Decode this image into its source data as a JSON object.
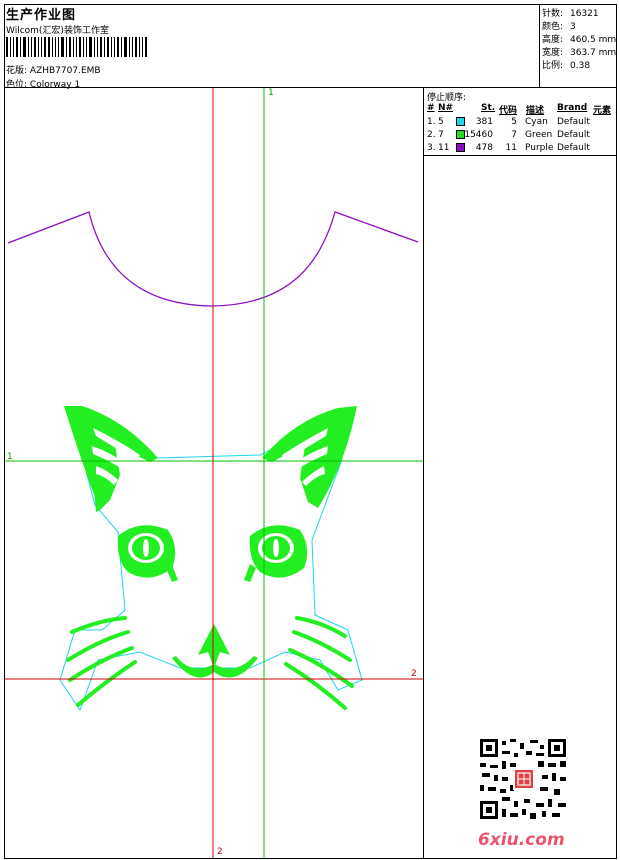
{
  "header": {
    "title": "生产作业图",
    "company": "Wilcom(汇宏)装饰工作室",
    "design_label": "花版:",
    "design_file": "AZHB7707.EMB",
    "color_label": "色位:",
    "colorway": "Colorway 1"
  },
  "stats": [
    {
      "key": "针数:",
      "value": "16321"
    },
    {
      "key": "颜色:",
      "value": "3"
    },
    {
      "key": "高度:",
      "value": "460.5 mm"
    },
    {
      "key": "宽度:",
      "value": "363.7 mm"
    },
    {
      "key": "比例:",
      "value": "0.38"
    }
  ],
  "stop_sequence": {
    "title": "停止顺序:",
    "headers": [
      "#",
      "N#",
      "St.",
      "代码",
      "描述",
      "Brand",
      "元素"
    ],
    "rows": [
      {
        "idx": "1.",
        "n": "5",
        "color": "#1ed6e6",
        "stitches": "381",
        "code": "5",
        "desc": "Cyan",
        "brand": "Default"
      },
      {
        "idx": "2.",
        "n": "7",
        "color": "#22dd22",
        "stitches": "15460",
        "code": "7",
        "desc": "Green",
        "brand": "Default"
      },
      {
        "idx": "3.",
        "n": "11",
        "color": "#8e0fc2",
        "stitches": "478",
        "code": "11",
        "desc": "Purple",
        "brand": "Default"
      }
    ]
  },
  "axes": {
    "vertical_top": "1",
    "vertical_bottom": "2",
    "horizontal_left": "1",
    "horizontal_right": "2"
  },
  "colors": {
    "cyan": "#1ed6e6",
    "green": "#22ee22",
    "purple": "#8e0fc2",
    "red_guide": "#d00000",
    "green_guide": "#00c000"
  },
  "watermark": "6xiu.com"
}
